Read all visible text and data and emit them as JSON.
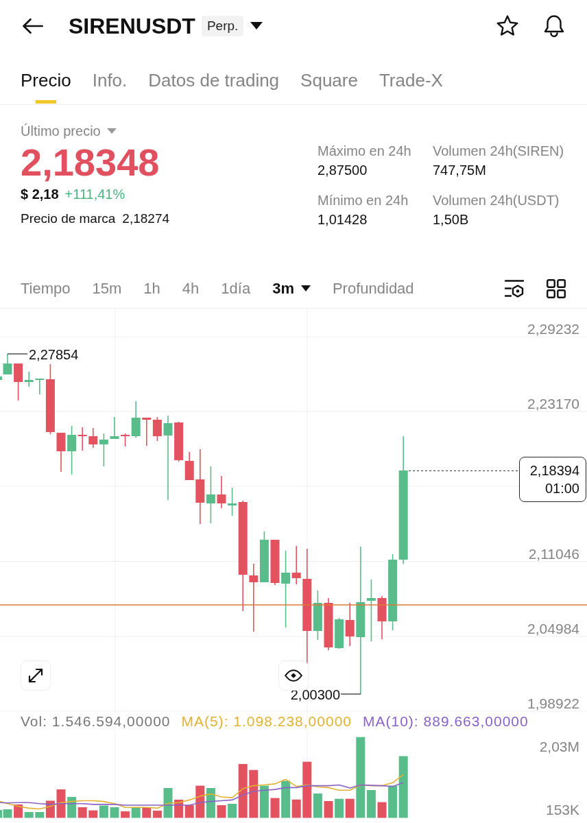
{
  "header": {
    "title": "SIRENUSDT",
    "badge": "Perp."
  },
  "tabs": [
    {
      "label": "Precio",
      "selected": true
    },
    {
      "label": "Info.",
      "selected": false
    },
    {
      "label": "Datos de trading",
      "selected": false
    },
    {
      "label": "Square",
      "selected": false
    },
    {
      "label": "Trade-X",
      "selected": false
    }
  ],
  "price": {
    "label": "Último precio",
    "value": "2,18348",
    "falling": true,
    "fiat": "$ 2,18",
    "change": "+111,41%",
    "change_rising": true,
    "mark_label": "Precio de marca",
    "mark_value": "2,18274"
  },
  "stats": [
    {
      "label": "Máximo en 24h",
      "value": "2,87500"
    },
    {
      "label": "Volumen 24h(SIREN)",
      "value": "747,75M"
    },
    {
      "label": "Mínimo en 24h",
      "value": "1,01428"
    },
    {
      "label": "Volumen 24h(USDT)",
      "value": "1,50B"
    }
  ],
  "intervals": [
    {
      "label": "Tiempo",
      "kind": "option",
      "selected": false
    },
    {
      "label": "15m",
      "kind": "option",
      "selected": false
    },
    {
      "label": "1h",
      "kind": "option",
      "selected": false
    },
    {
      "label": "4h",
      "kind": "option",
      "selected": false
    },
    {
      "label": "1día",
      "kind": "option",
      "selected": false
    },
    {
      "label": "3m",
      "kind": "menu",
      "selected": true
    },
    {
      "label": "Profundidad",
      "kind": "option",
      "selected": false
    }
  ],
  "chart": {
    "y_axis": [
      "2,29232",
      "2,23170",
      "2,11046",
      "2,04984",
      "1,98922"
    ],
    "high_marker": "2,27854",
    "low_marker": "2,00300",
    "price_tag": {
      "value": "2,18394",
      "countdown": "01:00"
    }
  },
  "volume": {
    "legend": [
      {
        "text": "Vol: 1.546.594,00000",
        "color": "#777777"
      },
      {
        "text": "MA(5): 1.098.238,00000",
        "color": "#e3b232"
      },
      {
        "text": "MA(10): 889.663,00000",
        "color": "#8a63c9"
      }
    ],
    "y_axis": [
      "2,03M",
      "153K"
    ]
  }
}
